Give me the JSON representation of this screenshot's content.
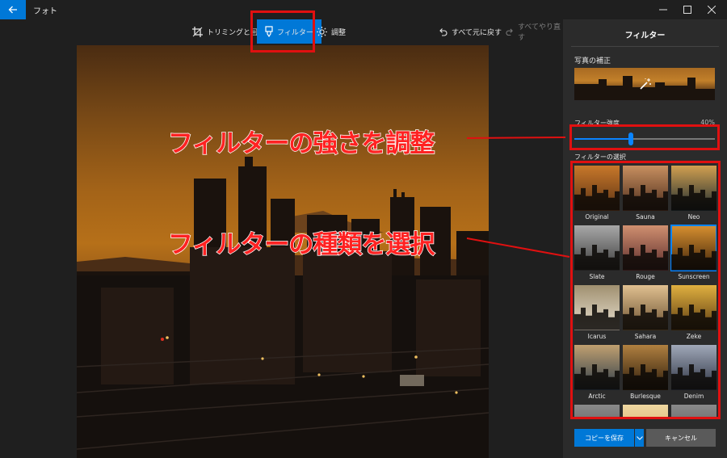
{
  "window": {
    "title": "フォト",
    "back_icon": "back-arrow-icon",
    "controls": [
      "minimize-icon",
      "maximize-icon",
      "close-icon"
    ]
  },
  "toolbar": {
    "crop_label": "トリミングと回転",
    "filter_label": "フィルター",
    "adjust_label": "調整",
    "undo_all_label": "すべて元に戻す",
    "redo_all_label": "すべてやり直す"
  },
  "panel": {
    "title": "フィルター",
    "enhance_label": "写真の補正",
    "strength_label": "フィルター強度",
    "strength_value_text": "40%",
    "strength_value": 0.4,
    "selection_label": "フィルターの選択",
    "filters": [
      {
        "name": "Original",
        "selected": false
      },
      {
        "name": "Sauna",
        "selected": false
      },
      {
        "name": "Neo",
        "selected": false
      },
      {
        "name": "Slate",
        "selected": false
      },
      {
        "name": "Rouge",
        "selected": false
      },
      {
        "name": "Sunscreen",
        "selected": true
      },
      {
        "name": "Icarus",
        "selected": false
      },
      {
        "name": "Sahara",
        "selected": false
      },
      {
        "name": "Zeke",
        "selected": false
      },
      {
        "name": "Arctic",
        "selected": false
      },
      {
        "name": "Burlesque",
        "selected": false
      },
      {
        "name": "Denim",
        "selected": false
      }
    ],
    "save_copy_label": "コピーを保存",
    "cancel_label": "キャンセル"
  },
  "annotations": {
    "strength_caption": "フィルターの強さを調整",
    "type_caption": "フィルターの種類を選択"
  },
  "colors": {
    "accent": "#0078d7",
    "annotation": "#e01010",
    "panel_bg": "#2b2b2b",
    "app_bg": "#1f1f1f"
  }
}
